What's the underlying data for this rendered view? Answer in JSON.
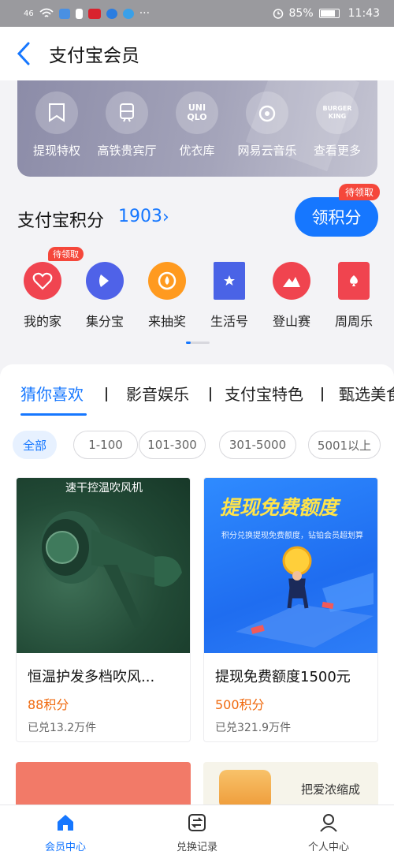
{
  "status_bar": {
    "signal": "46",
    "battery": "85%",
    "time": "11:43",
    "dots": "···"
  },
  "header": {
    "title": "支付宝会员"
  },
  "benefits": [
    {
      "label": "提现特权",
      "icon": "bookmark-icon",
      "glyph": ""
    },
    {
      "label": "高铁贵宾厅",
      "icon": "train-icon",
      "glyph": ""
    },
    {
      "label": "优衣库",
      "icon": "uniqlo-icon",
      "glyph": "UNI\nQLO"
    },
    {
      "label": "网易云音乐",
      "icon": "netease-music-icon",
      "glyph": ""
    },
    {
      "label": "查看更多",
      "icon": "burger-king-icon",
      "glyph": "BURGER\nKING"
    }
  ],
  "points": {
    "label": "支付宝积分",
    "value": "1903",
    "chevron": "›",
    "claim_button": "领积分",
    "claim_badge": "待领取"
  },
  "apps": [
    {
      "label": "我的家",
      "icon": "home-heart-icon",
      "color": "#f04450",
      "badge": "待领取"
    },
    {
      "label": "集分宝",
      "icon": "jifenbao-icon",
      "color": "#4f62e8",
      "badge": ""
    },
    {
      "label": "来抽奖",
      "icon": "lottery-icon",
      "color": "#ff9a1f",
      "badge": ""
    },
    {
      "label": "生活号",
      "icon": "life-account-icon",
      "color": "#4a63e6",
      "badge": ""
    },
    {
      "label": "登山赛",
      "icon": "mountain-race-icon",
      "color": "#f0444f",
      "badge": ""
    },
    {
      "label": "周周乐",
      "icon": "weekly-game-icon",
      "color": "#f0444f",
      "badge": ""
    }
  ],
  "tabs": [
    {
      "label": "猜你喜欢",
      "active": true
    },
    {
      "label": "影音娱乐",
      "active": false
    },
    {
      "label": "支付宝特色",
      "active": false
    },
    {
      "label": "甄选美食",
      "active": false
    }
  ],
  "filters": [
    {
      "label": "全部",
      "active": true
    },
    {
      "label": "1-100",
      "active": false
    },
    {
      "label": "101-300",
      "active": false
    },
    {
      "label": "301-5000",
      "active": false
    },
    {
      "label": "5001以上",
      "active": false
    }
  ],
  "products": [
    {
      "image_caption": "速干控温吹风机",
      "title": "恒温护发多档吹风...",
      "price": "88积分",
      "sold": "已兑13.2万件"
    },
    {
      "image_caption": "提现免费额度",
      "image_sub": "积分兑换提现免费额度，钻铂会员超划算",
      "title": "提现免费额度1500元",
      "price": "500积分",
      "sold": "已兑321.9万件"
    }
  ],
  "peek": {
    "text_line": "把爱浓缩成"
  },
  "bottom_nav": [
    {
      "label": "会员中心",
      "icon": "member-home-icon",
      "active": true
    },
    {
      "label": "兑换记录",
      "icon": "exchange-record-icon",
      "active": false
    },
    {
      "label": "个人中心",
      "icon": "profile-icon",
      "active": false
    }
  ],
  "colors": {
    "accent": "#1677ff",
    "price": "#f06a0f",
    "badge": "#f5473b"
  }
}
